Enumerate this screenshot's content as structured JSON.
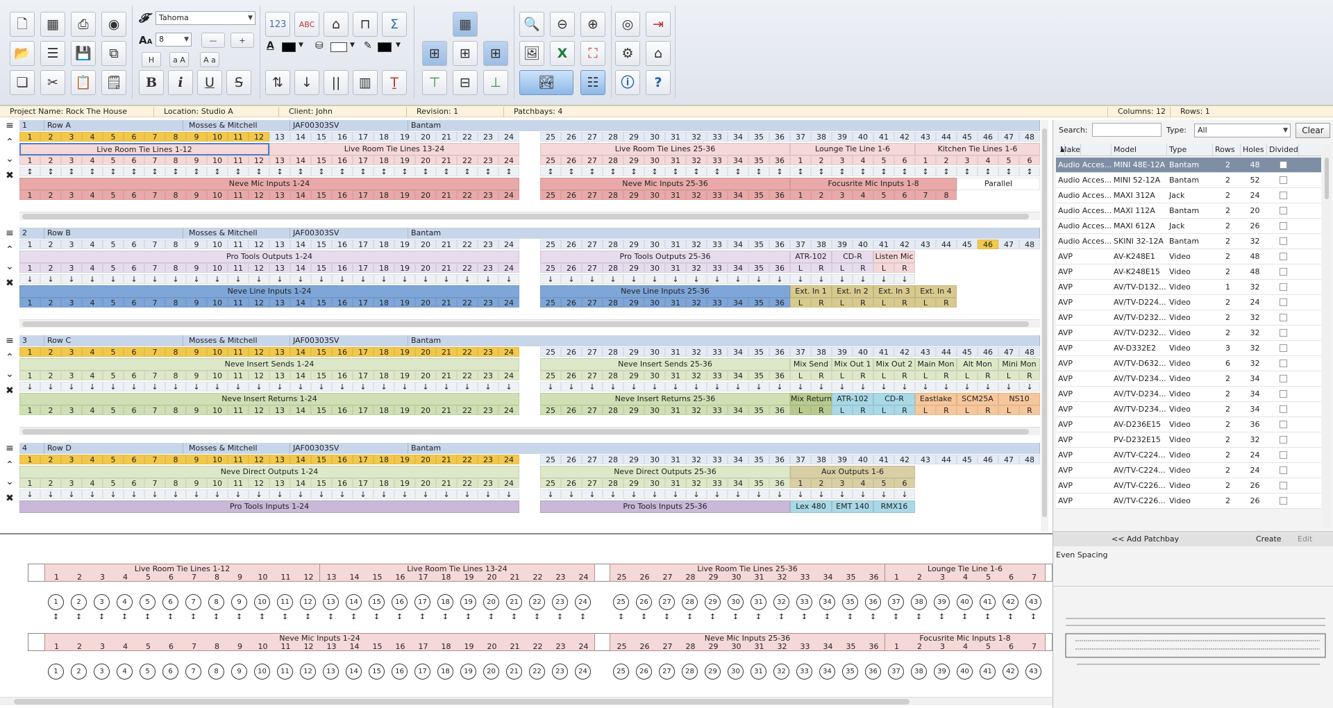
{
  "toolbar": {
    "font_name": "Tahoma",
    "font_size": "8",
    "buttons_left": [
      "new-icon",
      "spreadsheet-icon",
      "print-icon",
      "globe-icon",
      "open-icon",
      "list-icon",
      "save-icon",
      "save-all-icon",
      "copy-icon",
      "cut-icon",
      "paste-icon",
      "clipboard-icon"
    ],
    "text_buttons": {
      "h": "H",
      "aa1": "a A",
      "aa2": "A a",
      "bold": "B",
      "italic": "i",
      "underline": "U",
      "strike": "S",
      "num": "123",
      "abc": "ABC",
      "font_color": "A"
    },
    "colors": {
      "text": "#000000",
      "fill": "#ffffff",
      "line": "#000000"
    }
  },
  "infobar": {
    "project": "Project Name: Rock The House",
    "location": "Location: Studio A",
    "client": "Client: John",
    "revision": "Revision: 1",
    "patchbays": "Patchbays: 4",
    "columns": "Columns: 12",
    "rows": "Rows: 1"
  },
  "patchbays": [
    {
      "num": "1",
      "row": "Row A",
      "maker": "Mosses & Mitchell",
      "model": "JAF00303SV",
      "type": "Bantam",
      "header_highlight": 12,
      "top_labels": [
        {
          "text": "Live Room Tie Lines 1-12",
          "from": 1,
          "to": 12,
          "color": "#f5d8d8",
          "selected": true
        },
        {
          "text": "Live Room Tie Lines 13-24",
          "from": 13,
          "to": 24,
          "color": "#f5d8d8"
        },
        {
          "text": "Live Room Tie Lines 25-36",
          "from": 25,
          "to": 36,
          "color": "#f5d8d8"
        },
        {
          "text": "Lounge Tie Line 1-6",
          "from": 37,
          "to": 42,
          "color": "#f5d8d8"
        },
        {
          "text": "Kitchen Tie Lines 1-6",
          "from": 43,
          "to": 48,
          "color": "#f5d8d8"
        }
      ],
      "top_nums": [
        [
          1,
          24,
          1
        ],
        [
          25,
          36,
          25
        ],
        [
          37,
          42,
          1
        ],
        [
          43,
          48,
          1
        ]
      ],
      "mid_arrow": "↕",
      "bottom_labels": [
        {
          "text": "Neve Mic Inputs 1-24",
          "from": 1,
          "to": 24,
          "color": "#e9a9a9"
        },
        {
          "text": "Neve Mic Inputs 25-36",
          "from": 25,
          "to": 36,
          "color": "#e9a9a9"
        },
        {
          "text": "Focusrite Mic Inputs 1-8",
          "from": 37,
          "to": 44,
          "color": "#e9a9a9"
        },
        {
          "text": "Parallel",
          "from": 45,
          "to": 48,
          "color": "#ffffff"
        }
      ],
      "bottom_nums": [
        [
          1,
          24,
          1
        ],
        [
          25,
          36,
          25
        ],
        [
          37,
          44,
          1
        ]
      ]
    },
    {
      "num": "2",
      "row": "Row B",
      "maker": "Mosses & Mitchell",
      "model": "JAF00303SV",
      "type": "Bantam",
      "header_highlight": 0,
      "hl_col": 46,
      "top_labels": [
        {
          "text": "Pro Tools Outputs 1-24",
          "from": 1,
          "to": 24,
          "color": "#e6dcee"
        },
        {
          "text": "Pro Tools Outputs 25-36",
          "from": 25,
          "to": 36,
          "color": "#e6dcee"
        },
        {
          "text": "ATR-102",
          "from": 37,
          "to": 38,
          "color": "#e6dcee"
        },
        {
          "text": "CD-R",
          "from": 39,
          "to": 40,
          "color": "#e6dcee"
        },
        {
          "text": "Listen Mic",
          "from": 41,
          "to": 42,
          "color": "#f5d8d8"
        }
      ],
      "top_nums": [
        [
          1,
          24,
          1
        ],
        [
          25,
          36,
          25
        ]
      ],
      "top_lr": [
        [
          37,
          42
        ]
      ],
      "mid_arrow": "↓",
      "bottom_labels": [
        {
          "text": "Neve Line Inputs 1-24",
          "from": 1,
          "to": 24,
          "color": "#7ea6d8"
        },
        {
          "text": "Neve Line Inputs 25-36",
          "from": 25,
          "to": 36,
          "color": "#7ea6d8"
        },
        {
          "text": "Ext. In 1",
          "from": 37,
          "to": 38,
          "color": "#d8c98e"
        },
        {
          "text": "Ext. In 2",
          "from": 39,
          "to": 40,
          "color": "#d8c98e"
        },
        {
          "text": "Ext. In 3",
          "from": 41,
          "to": 42,
          "color": "#d8c98e"
        },
        {
          "text": "Ext. In 4",
          "from": 43,
          "to": 44,
          "color": "#d8c98e"
        }
      ],
      "bottom_nums": [
        [
          1,
          24,
          1
        ],
        [
          25,
          36,
          25
        ]
      ],
      "bottom_lr": [
        [
          37,
          44
        ]
      ]
    },
    {
      "num": "3",
      "row": "Row C",
      "maker": "Mosses & Mitchell",
      "model": "JAF00303SV",
      "type": "Bantam",
      "header_highlight": 24,
      "top_labels": [
        {
          "text": "Neve Insert Sends 1-24",
          "from": 1,
          "to": 24,
          "color": "#dde8c8"
        },
        {
          "text": "Neve Insert Sends 25-36",
          "from": 25,
          "to": 36,
          "color": "#dde8c8"
        },
        {
          "text": "Mix Send",
          "from": 37,
          "to": 38,
          "color": "#dde8c8"
        },
        {
          "text": "Mix Out 1",
          "from": 39,
          "to": 40,
          "color": "#dde8c8"
        },
        {
          "text": "Mix Out 2",
          "from": 41,
          "to": 42,
          "color": "#dde8c8"
        },
        {
          "text": "Main Mon",
          "from": 43,
          "to": 44,
          "color": "#dde8c8"
        },
        {
          "text": "Alt Mon",
          "from": 45,
          "to": 46,
          "color": "#dde8c8"
        },
        {
          "text": "Mini Mon",
          "from": 47,
          "to": 48,
          "color": "#dde8c8"
        }
      ],
      "top_nums": [
        [
          1,
          24,
          1
        ],
        [
          25,
          36,
          25
        ]
      ],
      "top_lr": [
        [
          37,
          48
        ]
      ],
      "mid_arrow": "↓",
      "bottom_labels": [
        {
          "text": "Neve Insert Returns 1-24",
          "from": 1,
          "to": 24,
          "color": "#cfe0b4"
        },
        {
          "text": "Neve Insert Returns 25-36",
          "from": 25,
          "to": 36,
          "color": "#cfe0b4"
        },
        {
          "text": "Mix Return",
          "from": 37,
          "to": 38,
          "color": "#b6cc8e"
        },
        {
          "text": "ATR-102",
          "from": 39,
          "to": 40,
          "color": "#a9d8e6"
        },
        {
          "text": "CD-R",
          "from": 41,
          "to": 42,
          "color": "#a9d8e6"
        },
        {
          "text": "Eastlake",
          "from": 43,
          "to": 44,
          "color": "#f7c79c"
        },
        {
          "text": "SCM25A",
          "from": 45,
          "to": 46,
          "color": "#f7c79c"
        },
        {
          "text": "NS10",
          "from": 47,
          "to": 48,
          "color": "#f7c79c"
        }
      ],
      "bottom_nums": [
        [
          1,
          24,
          1
        ],
        [
          25,
          36,
          25
        ]
      ],
      "bottom_lr": [
        [
          37,
          48
        ]
      ]
    },
    {
      "num": "4",
      "row": "Row D",
      "maker": "Mosses & Mitchell",
      "model": "JAF00303SV",
      "type": "Bantam",
      "header_highlight": 24,
      "top_labels": [
        {
          "text": "Neve Direct Outputs 1-24",
          "from": 1,
          "to": 24,
          "color": "#dde8c8"
        },
        {
          "text": "Neve Direct Outputs 25-36",
          "from": 25,
          "to": 36,
          "color": "#dde8c8"
        },
        {
          "text": "Aux Outputs 1-6",
          "from": 37,
          "to": 42,
          "color": "#d8cfa4"
        }
      ],
      "top_nums": [
        [
          1,
          24,
          1
        ],
        [
          25,
          36,
          25
        ],
        [
          37,
          42,
          1
        ]
      ],
      "mid_arrow": "↓",
      "bottom_labels": [
        {
          "text": "Pro Tools Inputs 1-24",
          "from": 1,
          "to": 24,
          "color": "#c9b8d8"
        },
        {
          "text": "Pro Tools Inputs 25-36",
          "from": 25,
          "to": 36,
          "color": "#c9b8d8"
        },
        {
          "text": "Lex 480",
          "from": 37,
          "to": 38,
          "color": "#a9d8e6"
        },
        {
          "text": "EMT 140",
          "from": 39,
          "to": 40,
          "color": "#a9d8e6"
        },
        {
          "text": "RMX16",
          "from": 41,
          "to": 42,
          "color": "#a9d8e6"
        }
      ],
      "bottom_nums": [],
      "bottom_lr": []
    }
  ],
  "side": {
    "search_label": "Search:",
    "type_label": "Type:",
    "type_value": "All",
    "clear": "Clear",
    "columns": [
      "Make",
      "Model",
      "Type",
      "Rows",
      "Holes",
      "Divided"
    ],
    "rows": [
      [
        "Audio Acces...",
        "MINI 48E-12A",
        "Bantam",
        "2",
        "48"
      ],
      [
        "Audio Acces...",
        "MINI 52-12A",
        "Bantam",
        "2",
        "52"
      ],
      [
        "Audio Acces...",
        "MAXI 312A",
        "Jack",
        "2",
        "24"
      ],
      [
        "Audio Acces...",
        "MAXI 112A",
        "Bantam",
        "2",
        "20"
      ],
      [
        "Audio Acces...",
        "MAXI 612A",
        "Jack",
        "2",
        "26"
      ],
      [
        "Audio Acces...",
        "SKINI 32-12A",
        "Bantam",
        "2",
        "32"
      ],
      [
        "AVP",
        "AV-K248E1",
        "Video",
        "2",
        "48"
      ],
      [
        "AVP",
        "AV-K248E15",
        "Video",
        "2",
        "48"
      ],
      [
        "AVP",
        "AV/TV-D132...",
        "Video",
        "1",
        "32"
      ],
      [
        "AVP",
        "AV/TV-D224...",
        "Video",
        "2",
        "24"
      ],
      [
        "AVP",
        "AV/TV-D232...",
        "Video",
        "2",
        "32"
      ],
      [
        "AVP",
        "AV/TV-D232...",
        "Video",
        "2",
        "32"
      ],
      [
        "AVP",
        "AV-D332E2",
        "Video",
        "3",
        "32"
      ],
      [
        "AVP",
        "AV/TV-D632...",
        "Video",
        "6",
        "32"
      ],
      [
        "AVP",
        "AV/TV-D234...",
        "Video",
        "2",
        "34"
      ],
      [
        "AVP",
        "AV/TV-D234...",
        "Video",
        "2",
        "34"
      ],
      [
        "AVP",
        "AV/TV-D234...",
        "Video",
        "2",
        "34"
      ],
      [
        "AVP",
        "AV-D236E15",
        "Video",
        "2",
        "36"
      ],
      [
        "AVP",
        "PV-D232E15",
        "Video",
        "2",
        "32"
      ],
      [
        "AVP",
        "AV/TV-C224...",
        "Video",
        "2",
        "24"
      ],
      [
        "AVP",
        "AV/TV-C224...",
        "Video",
        "2",
        "24"
      ],
      [
        "AVP",
        "AV/TV-C226...",
        "Video",
        "2",
        "26"
      ],
      [
        "AVP",
        "AV/TV-C226...",
        "Video",
        "2",
        "26"
      ]
    ],
    "add_patchbay": "<< Add Patchbay",
    "create": "Create",
    "edit": "Edit",
    "description": "Even Spacing"
  },
  "preview": {
    "top_labels": [
      "Live Room Tie Lines 1-12",
      "Live Room Tie Lines 13-24",
      "Live Room Tie Lines 25-36",
      "Lounge Tie Line 1-6"
    ],
    "bottom_labels": [
      "Neve Mic Inputs 1-24",
      "Neve Mic Inputs 25-36",
      "Focusrite Mic Inputs 1-8"
    ]
  }
}
